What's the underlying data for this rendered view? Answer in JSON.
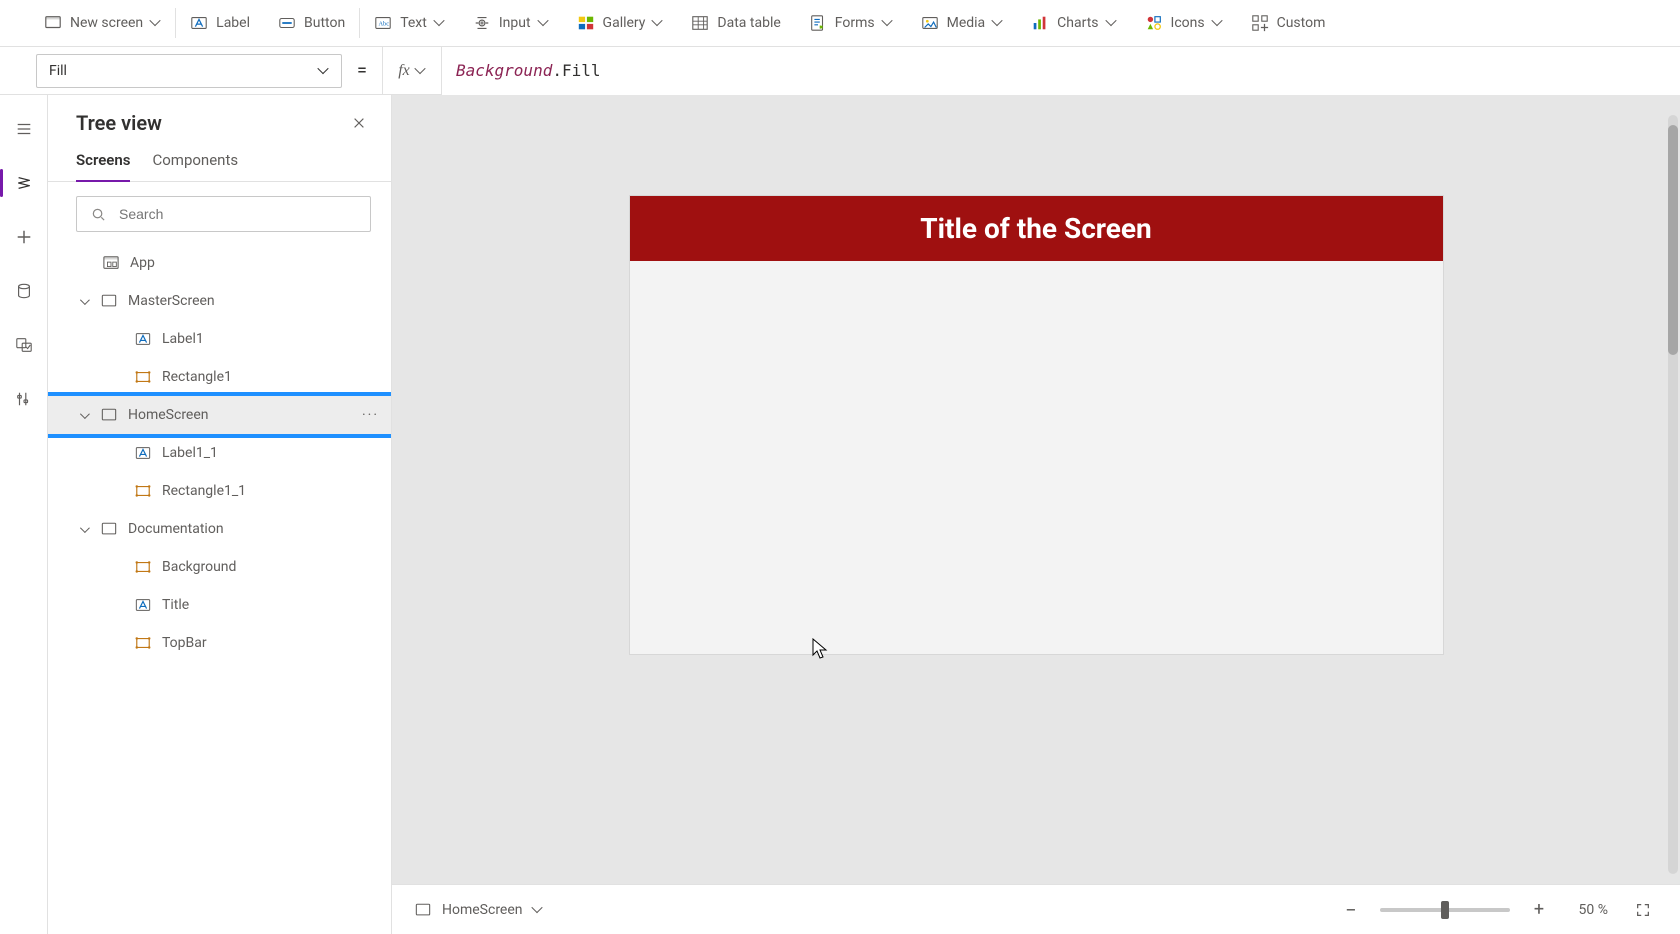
{
  "ribbon": {
    "new_screen": "New screen",
    "label": "Label",
    "button": "Button",
    "text": "Text",
    "input": "Input",
    "gallery": "Gallery",
    "data_table": "Data table",
    "forms": "Forms",
    "media": "Media",
    "charts": "Charts",
    "icons": "Icons",
    "custom": "Custom"
  },
  "formula_bar": {
    "property": "Fill",
    "equals": "=",
    "fx": "fx",
    "expr_ref": "Background",
    "expr_tail": ".Fill"
  },
  "tree": {
    "title": "Tree view",
    "tab_screens": "Screens",
    "tab_components": "Components",
    "search_placeholder": "Search",
    "more": "···",
    "items": {
      "app": "App",
      "master": "MasterScreen",
      "label1": "Label1",
      "rect1": "Rectangle1",
      "home": "HomeScreen",
      "label1_1": "Label1_1",
      "rect1_1": "Rectangle1_1",
      "doc": "Documentation",
      "background": "Background",
      "title": "Title",
      "topbar": "TopBar"
    }
  },
  "canvas": {
    "screen_title": "Title of the Screen"
  },
  "statusbar": {
    "screen_name": "HomeScreen",
    "zoom": "50 %",
    "minus": "−",
    "plus": "+"
  },
  "colors": {
    "highlight": "#1e90ff",
    "topbar": "#9f1010"
  }
}
